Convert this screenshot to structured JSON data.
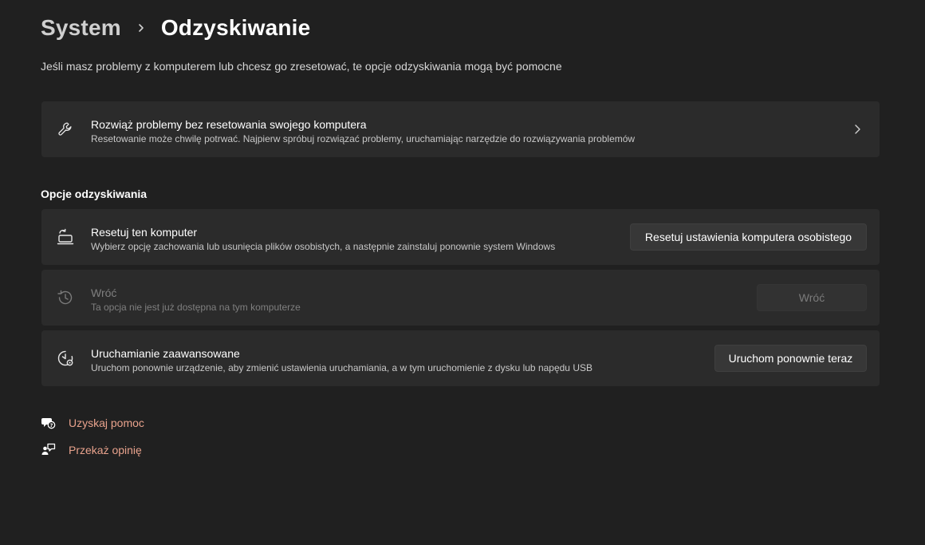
{
  "breadcrumb": {
    "parent": "System",
    "current": "Odzyskiwanie"
  },
  "subtitle": "Jeśli masz problemy z komputerem lub chcesz go zresetować, te opcje odzyskiwania mogą być pomocne",
  "troubleshoot_card": {
    "icon": "wrench-icon",
    "title": "Rozwiąż problemy bez resetowania swojego komputera",
    "description": "Resetowanie może chwilę potrwać. Najpierw spróbuj rozwiązać problemy, uruchamiając narzędzie do rozwiązywania problemów"
  },
  "section_title": "Opcje odzyskiwania",
  "options": [
    {
      "icon": "reset-pc-icon",
      "title": "Resetuj ten komputer",
      "description": "Wybierz opcję zachowania lub usunięcia plików osobistych, a następnie zainstaluj ponownie system Windows",
      "button": "Resetuj ustawienia komputera osobistego",
      "enabled": true
    },
    {
      "icon": "history-icon",
      "title": "Wróć",
      "description": "Ta opcja nie jest już dostępna na tym komputerze",
      "button": "Wróć",
      "enabled": false
    },
    {
      "icon": "advanced-startup-icon",
      "title": "Uruchamianie zaawansowane",
      "description": "Uruchom ponownie urządzenie, aby zmienić ustawienia uruchamiania, a w tym uruchomienie z dysku lub napędu USB",
      "button": "Uruchom ponownie teraz",
      "enabled": true
    }
  ],
  "links": [
    {
      "icon": "help-icon",
      "label": "Uzyskaj pomoc"
    },
    {
      "icon": "feedback-icon",
      "label": "Przekaż opinię"
    }
  ],
  "colors": {
    "background": "#202020",
    "card": "#2b2b2b",
    "button": "#373737",
    "accent_link": "#e8a28c",
    "disabled_text": "#7f7f7f"
  }
}
